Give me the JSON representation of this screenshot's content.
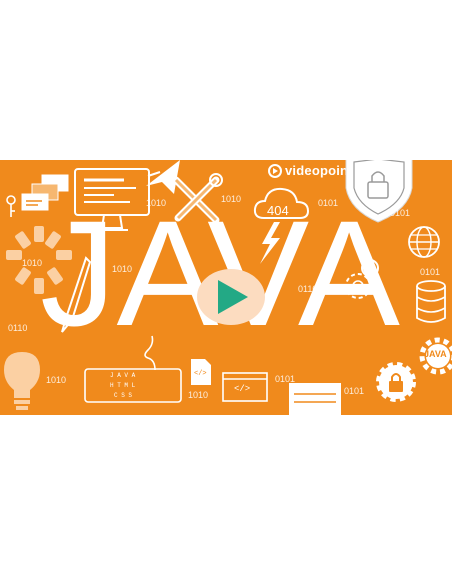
{
  "brand": {
    "name": "videopoint"
  },
  "title": {
    "text": "JAVA"
  },
  "cloud_label": "404",
  "java_badge": "JAVA",
  "code_tag": "</>",
  "keyboard_rows": [
    "J A V A",
    "H T M L",
    "C S S"
  ],
  "binary": [
    "1010",
    "0101",
    "1010",
    "0101",
    "1010",
    "0101",
    "1010",
    "0110",
    "0110",
    "1010",
    "0101",
    "1010",
    "0101"
  ],
  "colors": {
    "background": "#f08a1c",
    "page": "#ffffff",
    "accent": "#ffffff"
  },
  "icons": [
    "play-icon",
    "lock-shield-icon",
    "monitor-icon",
    "wrench-screwdriver-icon",
    "cloud-icon",
    "lightning-icon",
    "globe-icon",
    "database-icon",
    "gear-lock-icon",
    "gear-java-icon",
    "lightbulb-icon",
    "keyboard-icon",
    "code-window-icon",
    "file-code-icon",
    "browser-window-icon",
    "pen-icon",
    "loading-spinner-icon",
    "rocket-icon",
    "key-icon"
  ]
}
